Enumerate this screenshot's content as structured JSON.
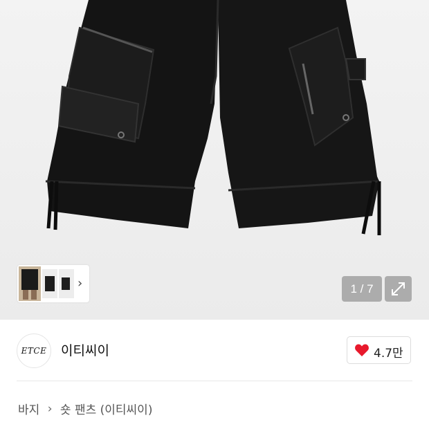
{
  "gallery": {
    "current_index": "1",
    "total": "7",
    "counter_text": "1 / 7",
    "thumbnail_more_icon": "chevron-right-icon",
    "expand_icon": "expand-arrows-icon"
  },
  "brand": {
    "logo_text": "ETCE",
    "name": "이티씨이"
  },
  "like": {
    "icon": "heart-icon",
    "icon_color": "#e8192c",
    "count": "4.7만"
  },
  "breadcrumb": {
    "category": "바지",
    "separator_icon": "chevron-right-icon",
    "subcategory": "숏 팬츠 (이티씨이)"
  }
}
